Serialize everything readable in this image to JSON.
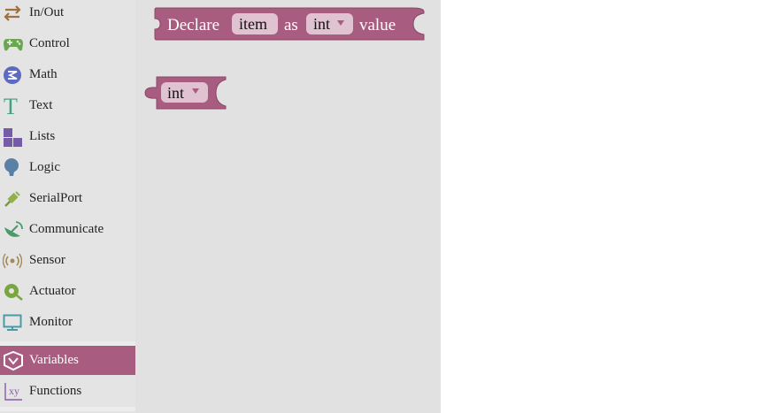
{
  "toolbox": {
    "categories": [
      {
        "label": "In/Out",
        "icon": "arrows-in-out-icon"
      },
      {
        "label": "Control",
        "icon": "gamepad-icon"
      },
      {
        "label": "Math",
        "icon": "math-circle-icon"
      },
      {
        "label": "Text",
        "icon": "text-t-icon"
      },
      {
        "label": "Lists",
        "icon": "squares-icon"
      },
      {
        "label": "Logic",
        "icon": "lightbulb-icon"
      },
      {
        "label": "SerialPort",
        "icon": "usb-plug-icon"
      },
      {
        "label": "Communicate",
        "icon": "satellite-dish-icon"
      },
      {
        "label": "Sensor",
        "icon": "sensor-waves-icon"
      },
      {
        "label": "Actuator",
        "icon": "motor-icon"
      },
      {
        "label": "Monitor",
        "icon": "monitor-icon"
      },
      {
        "label": "Variables",
        "icon": "variables-icon",
        "selected": true
      },
      {
        "label": "Functions",
        "icon": "function-xy-icon"
      }
    ]
  },
  "workspace": {
    "declare_block": {
      "word_declare": "Declare",
      "var_name": "item",
      "word_as": "as",
      "type": "int",
      "word_value": "value",
      "color": "#a85c80"
    },
    "type_block": {
      "type": "int",
      "color": "#a85c80"
    }
  },
  "colors": {
    "block": "#a85c80",
    "block_border": "#8b4667",
    "field_bg": "#e0c2d1",
    "selected_category": "#a85c80",
    "workspace_bg": "#e1e1e1",
    "toolbox_bg": "#e4e4e4"
  }
}
